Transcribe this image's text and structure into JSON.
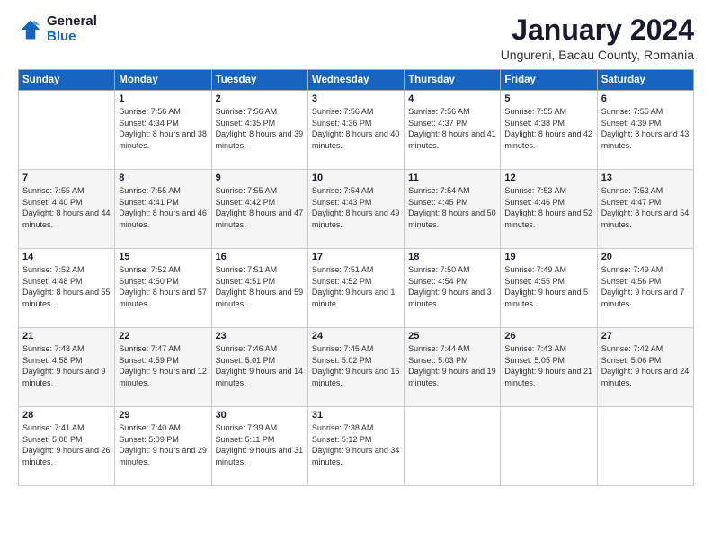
{
  "header": {
    "logo_general": "General",
    "logo_blue": "Blue",
    "title": "January 2024",
    "subtitle": "Ungureni, Bacau County, Romania"
  },
  "weekdays": [
    "Sunday",
    "Monday",
    "Tuesday",
    "Wednesday",
    "Thursday",
    "Friday",
    "Saturday"
  ],
  "weeks": [
    [
      {
        "day": "",
        "sunrise": "",
        "sunset": "",
        "daylight": ""
      },
      {
        "day": "1",
        "sunrise": "Sunrise: 7:56 AM",
        "sunset": "Sunset: 4:34 PM",
        "daylight": "Daylight: 8 hours and 38 minutes."
      },
      {
        "day": "2",
        "sunrise": "Sunrise: 7:56 AM",
        "sunset": "Sunset: 4:35 PM",
        "daylight": "Daylight: 8 hours and 39 minutes."
      },
      {
        "day": "3",
        "sunrise": "Sunrise: 7:56 AM",
        "sunset": "Sunset: 4:36 PM",
        "daylight": "Daylight: 8 hours and 40 minutes."
      },
      {
        "day": "4",
        "sunrise": "Sunrise: 7:56 AM",
        "sunset": "Sunset: 4:37 PM",
        "daylight": "Daylight: 8 hours and 41 minutes."
      },
      {
        "day": "5",
        "sunrise": "Sunrise: 7:55 AM",
        "sunset": "Sunset: 4:38 PM",
        "daylight": "Daylight: 8 hours and 42 minutes."
      },
      {
        "day": "6",
        "sunrise": "Sunrise: 7:55 AM",
        "sunset": "Sunset: 4:39 PM",
        "daylight": "Daylight: 8 hours and 43 minutes."
      }
    ],
    [
      {
        "day": "7",
        "sunrise": "Sunrise: 7:55 AM",
        "sunset": "Sunset: 4:40 PM",
        "daylight": "Daylight: 8 hours and 44 minutes."
      },
      {
        "day": "8",
        "sunrise": "Sunrise: 7:55 AM",
        "sunset": "Sunset: 4:41 PM",
        "daylight": "Daylight: 8 hours and 46 minutes."
      },
      {
        "day": "9",
        "sunrise": "Sunrise: 7:55 AM",
        "sunset": "Sunset: 4:42 PM",
        "daylight": "Daylight: 8 hours and 47 minutes."
      },
      {
        "day": "10",
        "sunrise": "Sunrise: 7:54 AM",
        "sunset": "Sunset: 4:43 PM",
        "daylight": "Daylight: 8 hours and 49 minutes."
      },
      {
        "day": "11",
        "sunrise": "Sunrise: 7:54 AM",
        "sunset": "Sunset: 4:45 PM",
        "daylight": "Daylight: 8 hours and 50 minutes."
      },
      {
        "day": "12",
        "sunrise": "Sunrise: 7:53 AM",
        "sunset": "Sunset: 4:46 PM",
        "daylight": "Daylight: 8 hours and 52 minutes."
      },
      {
        "day": "13",
        "sunrise": "Sunrise: 7:53 AM",
        "sunset": "Sunset: 4:47 PM",
        "daylight": "Daylight: 8 hours and 54 minutes."
      }
    ],
    [
      {
        "day": "14",
        "sunrise": "Sunrise: 7:52 AM",
        "sunset": "Sunset: 4:48 PM",
        "daylight": "Daylight: 8 hours and 55 minutes."
      },
      {
        "day": "15",
        "sunrise": "Sunrise: 7:52 AM",
        "sunset": "Sunset: 4:50 PM",
        "daylight": "Daylight: 8 hours and 57 minutes."
      },
      {
        "day": "16",
        "sunrise": "Sunrise: 7:51 AM",
        "sunset": "Sunset: 4:51 PM",
        "daylight": "Daylight: 8 hours and 59 minutes."
      },
      {
        "day": "17",
        "sunrise": "Sunrise: 7:51 AM",
        "sunset": "Sunset: 4:52 PM",
        "daylight": "Daylight: 9 hours and 1 minute."
      },
      {
        "day": "18",
        "sunrise": "Sunrise: 7:50 AM",
        "sunset": "Sunset: 4:54 PM",
        "daylight": "Daylight: 9 hours and 3 minutes."
      },
      {
        "day": "19",
        "sunrise": "Sunrise: 7:49 AM",
        "sunset": "Sunset: 4:55 PM",
        "daylight": "Daylight: 9 hours and 5 minutes."
      },
      {
        "day": "20",
        "sunrise": "Sunrise: 7:49 AM",
        "sunset": "Sunset: 4:56 PM",
        "daylight": "Daylight: 9 hours and 7 minutes."
      }
    ],
    [
      {
        "day": "21",
        "sunrise": "Sunrise: 7:48 AM",
        "sunset": "Sunset: 4:58 PM",
        "daylight": "Daylight: 9 hours and 9 minutes."
      },
      {
        "day": "22",
        "sunrise": "Sunrise: 7:47 AM",
        "sunset": "Sunset: 4:59 PM",
        "daylight": "Daylight: 9 hours and 12 minutes."
      },
      {
        "day": "23",
        "sunrise": "Sunrise: 7:46 AM",
        "sunset": "Sunset: 5:01 PM",
        "daylight": "Daylight: 9 hours and 14 minutes."
      },
      {
        "day": "24",
        "sunrise": "Sunrise: 7:45 AM",
        "sunset": "Sunset: 5:02 PM",
        "daylight": "Daylight: 9 hours and 16 minutes."
      },
      {
        "day": "25",
        "sunrise": "Sunrise: 7:44 AM",
        "sunset": "Sunset: 5:03 PM",
        "daylight": "Daylight: 9 hours and 19 minutes."
      },
      {
        "day": "26",
        "sunrise": "Sunrise: 7:43 AM",
        "sunset": "Sunset: 5:05 PM",
        "daylight": "Daylight: 9 hours and 21 minutes."
      },
      {
        "day": "27",
        "sunrise": "Sunrise: 7:42 AM",
        "sunset": "Sunset: 5:06 PM",
        "daylight": "Daylight: 9 hours and 24 minutes."
      }
    ],
    [
      {
        "day": "28",
        "sunrise": "Sunrise: 7:41 AM",
        "sunset": "Sunset: 5:08 PM",
        "daylight": "Daylight: 9 hours and 26 minutes."
      },
      {
        "day": "29",
        "sunrise": "Sunrise: 7:40 AM",
        "sunset": "Sunset: 5:09 PM",
        "daylight": "Daylight: 9 hours and 29 minutes."
      },
      {
        "day": "30",
        "sunrise": "Sunrise: 7:39 AM",
        "sunset": "Sunset: 5:11 PM",
        "daylight": "Daylight: 9 hours and 31 minutes."
      },
      {
        "day": "31",
        "sunrise": "Sunrise: 7:38 AM",
        "sunset": "Sunset: 5:12 PM",
        "daylight": "Daylight: 9 hours and 34 minutes."
      },
      {
        "day": "",
        "sunrise": "",
        "sunset": "",
        "daylight": ""
      },
      {
        "day": "",
        "sunrise": "",
        "sunset": "",
        "daylight": ""
      },
      {
        "day": "",
        "sunrise": "",
        "sunset": "",
        "daylight": ""
      }
    ]
  ]
}
